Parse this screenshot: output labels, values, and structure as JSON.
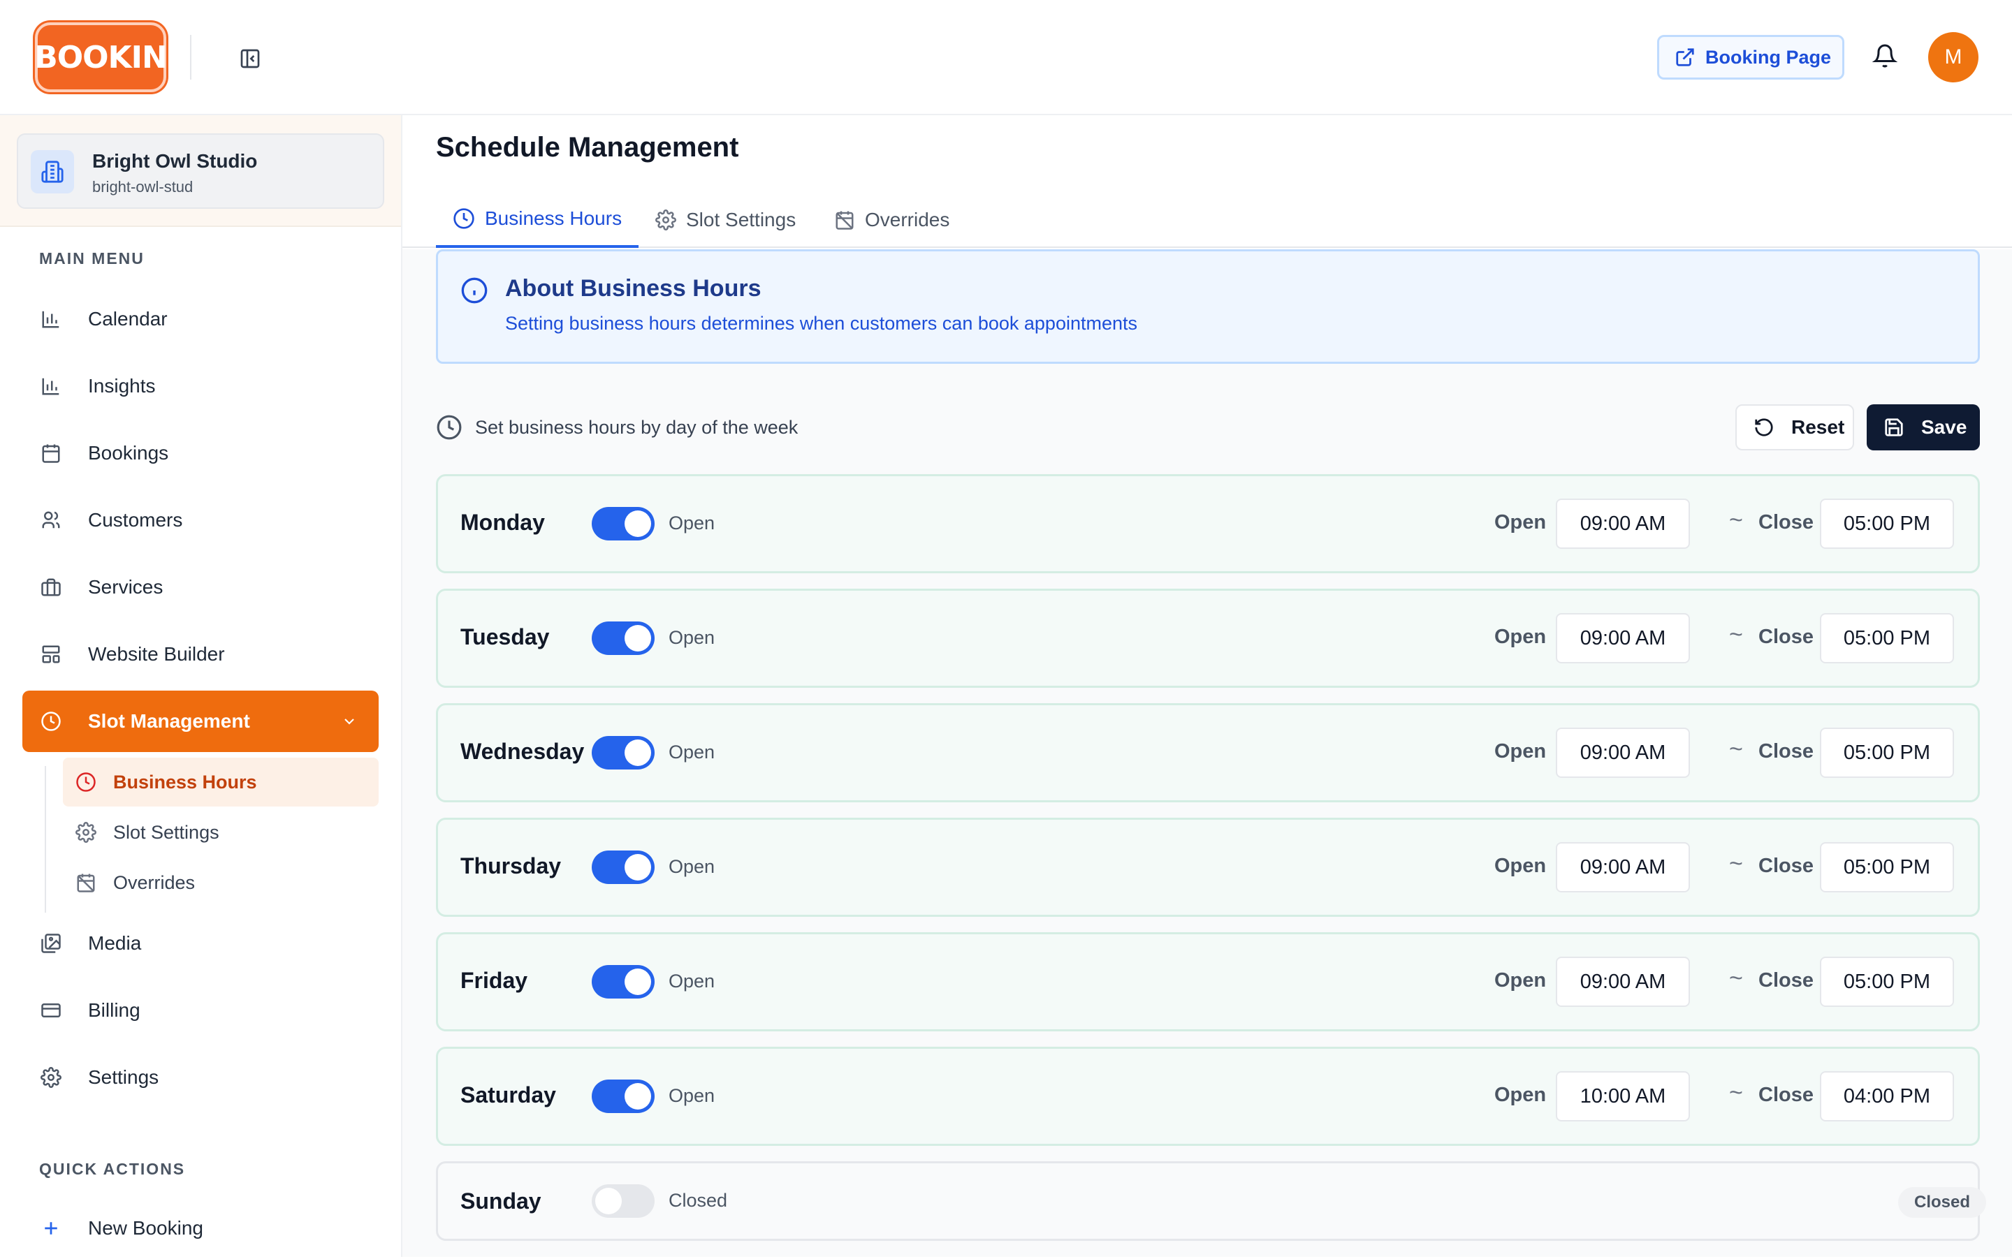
{
  "header": {
    "logo_text": "BOOKIN",
    "booking_page_label": "Booking Page",
    "avatar_initial": "M"
  },
  "sidebar": {
    "org": {
      "name": "Bright Owl Studio",
      "slug": "bright-owl-stud"
    },
    "main_menu_label": "MAIN MENU",
    "items": [
      {
        "label": "Calendar",
        "icon": "bar-chart-icon"
      },
      {
        "label": "Insights",
        "icon": "bar-chart-icon"
      },
      {
        "label": "Bookings",
        "icon": "calendar-icon"
      },
      {
        "label": "Customers",
        "icon": "users-icon"
      },
      {
        "label": "Services",
        "icon": "briefcase-icon"
      },
      {
        "label": "Website Builder",
        "icon": "layout-icon"
      },
      {
        "label": "Slot Management",
        "icon": "clock-icon"
      },
      {
        "label": "Media",
        "icon": "images-icon"
      },
      {
        "label": "Billing",
        "icon": "credit-card-icon"
      },
      {
        "label": "Settings",
        "icon": "gear-icon"
      }
    ],
    "sub_items": [
      {
        "label": "Business Hours",
        "icon": "clock-icon"
      },
      {
        "label": "Slot Settings",
        "icon": "gear-icon"
      },
      {
        "label": "Overrides",
        "icon": "calendar-off-icon"
      }
    ],
    "quick_actions_label": "QUICK ACTIONS",
    "new_booking_label": "New Booking"
  },
  "main": {
    "title": "Schedule Management",
    "tabs": [
      {
        "label": "Business Hours",
        "active": true
      },
      {
        "label": "Slot Settings",
        "active": false
      },
      {
        "label": "Overrides",
        "active": false
      }
    ],
    "info": {
      "title": "About Business Hours",
      "text": "Setting business hours determines when customers can book appointments"
    },
    "set_label": "Set business hours by day of the week",
    "reset_label": "Reset",
    "save_label": "Save",
    "open_label": "Open",
    "close_label": "Close",
    "days": [
      {
        "name": "Monday",
        "status": "Open",
        "open": "09:00 AM",
        "close": "05:00 PM"
      },
      {
        "name": "Tuesday",
        "status": "Open",
        "open": "09:00 AM",
        "close": "05:00 PM"
      },
      {
        "name": "Wednesday",
        "status": "Open",
        "open": "09:00 AM",
        "close": "05:00 PM"
      },
      {
        "name": "Thursday",
        "status": "Open",
        "open": "09:00 AM",
        "close": "05:00 PM"
      },
      {
        "name": "Friday",
        "status": "Open",
        "open": "09:00 AM",
        "close": "05:00 PM"
      },
      {
        "name": "Saturday",
        "status": "Open",
        "open": "10:00 AM",
        "close": "04:00 PM"
      },
      {
        "name": "Sunday",
        "status": "Closed",
        "badge": "Closed"
      }
    ]
  },
  "colors": {
    "brand": "#f26522",
    "accent": "#2563eb",
    "active_nav": "#ef6c0e",
    "save_button": "#0f1b33"
  }
}
